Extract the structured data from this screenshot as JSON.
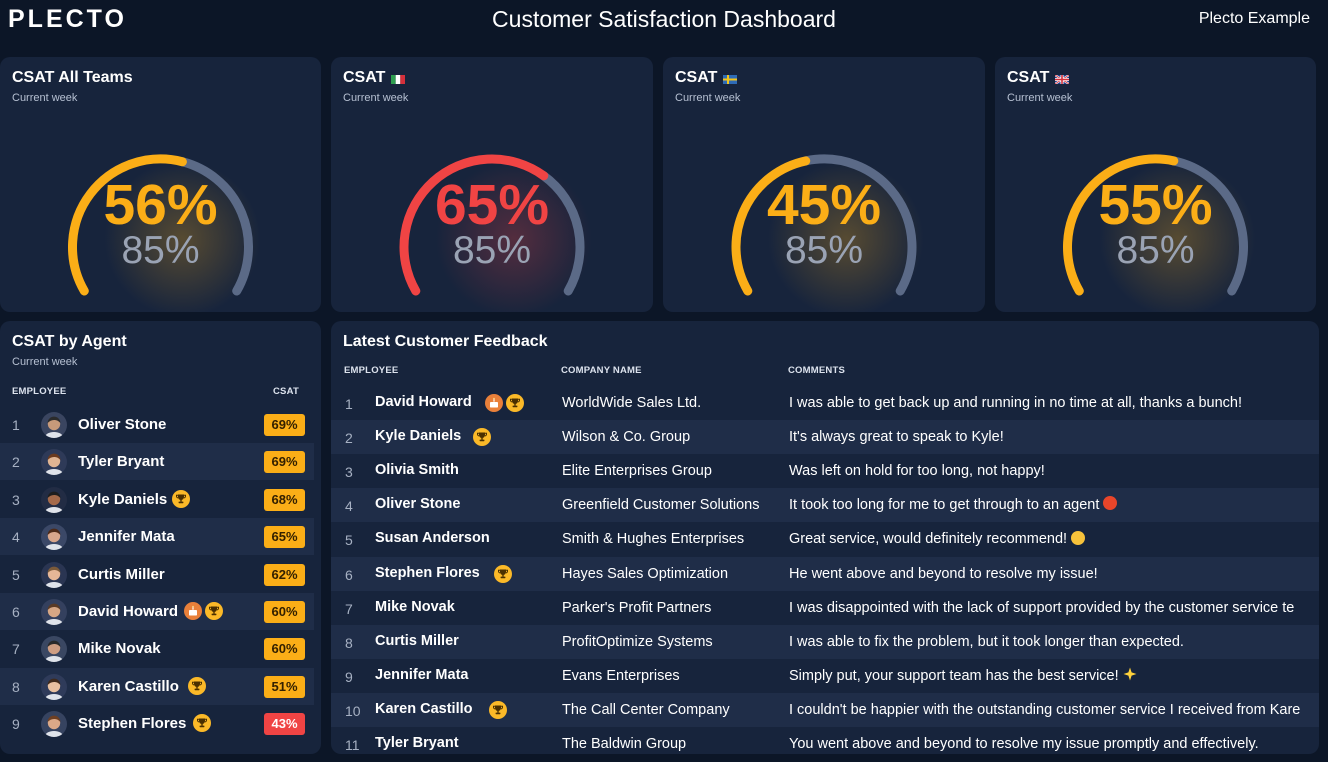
{
  "header": {
    "logo": "PLECTO",
    "title": "Customer Satisfaction Dashboard",
    "right_label": "Plecto Example"
  },
  "colors": {
    "background": "#0c1627",
    "card": "#17243c",
    "row_alt": "#1f2d48",
    "orange": "#fbae17",
    "red": "#f04444",
    "track": "#5b6a87",
    "muted_text": "#9aa3b4"
  },
  "gauges": [
    {
      "title": "CSAT All Teams",
      "flag": "",
      "subtitle": "Current week",
      "value_label": "56%",
      "target_label": "85%",
      "fraction": 0.56,
      "color": "#fbae17"
    },
    {
      "title": "CSAT",
      "flag": "italy-flag",
      "subtitle": "Current week",
      "value_label": "65%",
      "target_label": "85%",
      "fraction": 0.65,
      "color": "#f04444"
    },
    {
      "title": "CSAT",
      "flag": "sweden-flag",
      "subtitle": "Current week",
      "value_label": "45%",
      "target_label": "85%",
      "fraction": 0.45,
      "color": "#fbae17"
    },
    {
      "title": "CSAT",
      "flag": "uk-flag",
      "subtitle": "Current week",
      "value_label": "55%",
      "target_label": "85%",
      "fraction": 0.55,
      "color": "#fbae17"
    }
  ],
  "agents": {
    "title": "CSAT by Agent",
    "subtitle": "Current week",
    "col_employee": "EMPLOYEE",
    "col_csat": "CSAT",
    "rows": [
      {
        "rank": "1",
        "name": "Oliver Stone",
        "csat": "69%",
        "badges": [],
        "color": "#fbae17"
      },
      {
        "rank": "2",
        "name": "Tyler Bryant",
        "csat": "69%",
        "badges": [],
        "color": "#fbae17"
      },
      {
        "rank": "3",
        "name": "Kyle Daniels",
        "csat": "68%",
        "badges": [
          "trophy-icon"
        ],
        "color": "#fbae17"
      },
      {
        "rank": "4",
        "name": "Jennifer Mata",
        "csat": "65%",
        "badges": [],
        "color": "#fbae17"
      },
      {
        "rank": "5",
        "name": "Curtis Miller",
        "csat": "62%",
        "badges": [],
        "color": "#fbae17"
      },
      {
        "rank": "6",
        "name": "David Howard",
        "csat": "60%",
        "badges": [
          "cake-icon",
          "trophy-icon"
        ],
        "color": "#fbae17"
      },
      {
        "rank": "7",
        "name": "Mike Novak",
        "csat": "60%",
        "badges": [],
        "color": "#fbae17"
      },
      {
        "rank": "8",
        "name": "Karen Castillo",
        "csat": "51%",
        "badges": [
          "trophy-icon"
        ],
        "color": "#fbae17"
      },
      {
        "rank": "9",
        "name": "Stephen Flores",
        "csat": "43%",
        "badges": [
          "trophy-icon"
        ],
        "color": "#f04444"
      }
    ]
  },
  "feedback": {
    "title": "Latest Customer Feedback",
    "col_employee": "EMPLOYEE",
    "col_company": "COMPANY NAME",
    "col_comments": "COMMENTS",
    "rows": [
      {
        "num": "1",
        "name": "David Howard",
        "badges": [
          "cake-icon",
          "trophy-icon"
        ],
        "company": "WorldWide Sales Ltd.",
        "comment": "I was able to get back up and running in no time at all, thanks a bunch!",
        "emoji": ""
      },
      {
        "num": "2",
        "name": "Kyle Daniels",
        "badges": [
          "trophy-icon"
        ],
        "company": "Wilson & Co. Group",
        "comment": "It's always great to speak to Kyle!",
        "emoji": ""
      },
      {
        "num": "3",
        "name": "Olivia Smith",
        "badges": [],
        "company": "Elite Enterprises Group",
        "comment": "Was left on hold for too long, not happy!",
        "emoji": ""
      },
      {
        "num": "4",
        "name": "Oliver Stone",
        "badges": [],
        "company": "Greenfield Customer Solutions",
        "comment": "It took too long for me to get through to an agent",
        "emoji": "angry-face-icon"
      },
      {
        "num": "5",
        "name": "Susan Anderson",
        "badges": [],
        "company": "Smith & Hughes Enterprises",
        "comment": "Great service, would definitely recommend!",
        "emoji": "smiley-face-icon"
      },
      {
        "num": "6",
        "name": "Stephen Flores",
        "badges": [
          "trophy-icon"
        ],
        "company": "Hayes Sales Optimization",
        "comment": "He went above and beyond to resolve my issue!",
        "emoji": ""
      },
      {
        "num": "7",
        "name": "Mike Novak",
        "badges": [],
        "company": "Parker's Profit Partners",
        "comment": "I was disappointed with the lack of support provided by the customer service te",
        "emoji": ""
      },
      {
        "num": "8",
        "name": "Curtis Miller",
        "badges": [],
        "company": "ProfitOptimize Systems",
        "comment": "I was able to fix the problem, but it took longer than expected.",
        "emoji": ""
      },
      {
        "num": "9",
        "name": "Jennifer Mata",
        "badges": [],
        "company": "Evans Enterprises",
        "comment": "Simply put, your support team has the best service!",
        "emoji": "sparkle-star-icon"
      },
      {
        "num": "10",
        "name": "Karen Castillo",
        "badges": [
          "trophy-icon"
        ],
        "company": "The Call Center Company",
        "comment": "I couldn't be happier with the outstanding customer service I received from Kare",
        "emoji": ""
      },
      {
        "num": "11",
        "name": "Tyler Bryant",
        "badges": [],
        "company": "The Baldwin Group",
        "comment": "You went above and beyond to resolve my issue promptly and effectively.",
        "emoji": ""
      }
    ]
  }
}
